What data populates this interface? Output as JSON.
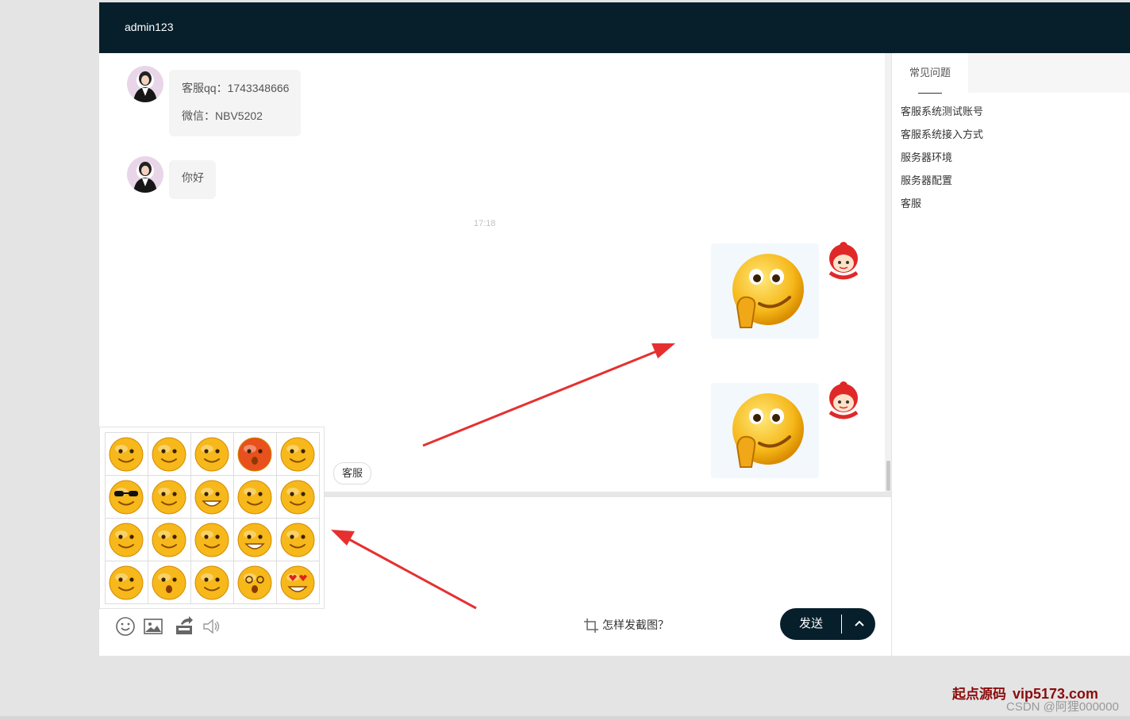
{
  "header": {
    "title": "admin123"
  },
  "chat": {
    "messages": [
      {
        "side": "agent",
        "lines": [
          "客服qq：1743348666",
          "微信：NBV5202"
        ]
      },
      {
        "side": "agent",
        "lines": [
          "你好"
        ]
      }
    ],
    "timestamp": "17:18",
    "sent": [
      {
        "side": "user",
        "content": "emoji-image"
      },
      {
        "side": "user",
        "content": "emoji-image"
      }
    ],
    "quick_reply": "客服"
  },
  "toolbar": {
    "screenshot_help": "怎样发截图？",
    "send_label": "发送",
    "icons": [
      "smile-icon",
      "image-icon",
      "upload-icon",
      "speaker-icon"
    ]
  },
  "faq": {
    "tab_label": "常见问题",
    "items": [
      "客服系统测试账号",
      "客服系统接入方式",
      "服务器环境",
      "服务器配置",
      "客服"
    ]
  },
  "emoji_picker": {
    "rows": 4,
    "cols": 5,
    "emojis": [
      "content-face",
      "shy-face",
      "teary-face",
      "sad-red-face",
      "peeking-face",
      "sunglasses-face",
      "dizzy-face",
      "grin-face",
      "covering-mouth-face",
      "crying-face",
      "kiss-face",
      "angry-fire-face",
      "clapping-face",
      "big-grin-face",
      "annoyed-face",
      "sweat-face",
      "shocked-face",
      "sly-face",
      "spiral-eyes-face",
      "heart-eyes-face"
    ]
  },
  "colors": {
    "header_bg": "#061f2b",
    "send_bg": "#061f2b",
    "bubble_left": "#f4f4f4",
    "bubble_right": "#f3f8fd",
    "arrow": "#e63030",
    "emoji_yellow": "#f6b81a"
  },
  "watermark": {
    "brand": "起点源码",
    "url": "vip5173.com",
    "csdn": "CSDN @阿狸000000"
  }
}
